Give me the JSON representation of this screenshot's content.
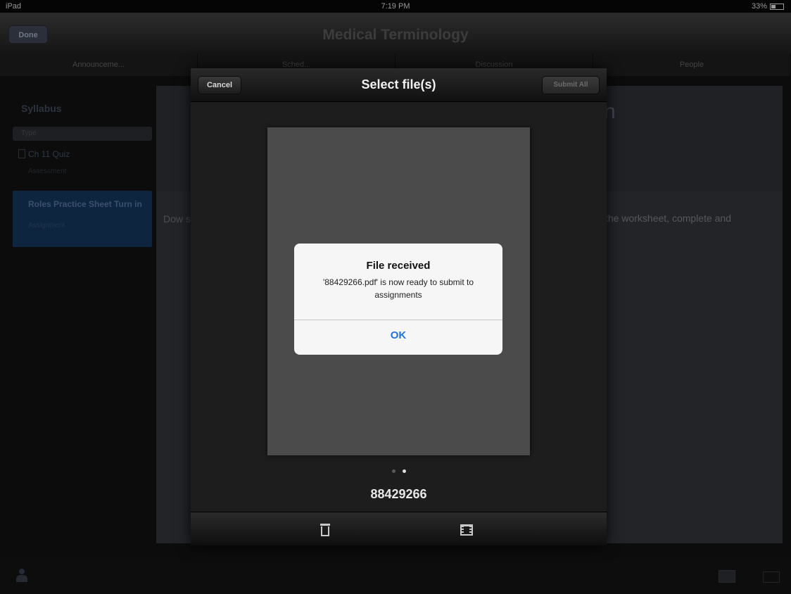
{
  "status_bar": {
    "carrier": "iPad",
    "time": "7:19 PM",
    "battery": "33%"
  },
  "nav": {
    "done_label": "Done",
    "title": "Medical Terminology"
  },
  "tabs": [
    {
      "label": "Announceme..."
    },
    {
      "label": "Sched..."
    },
    {
      "label": "Discussion"
    },
    {
      "label": "People"
    }
  ],
  "sidebar": {
    "title": "Syllabus",
    "filter_label": "Type",
    "items": [
      {
        "label": "Ch 11 Quiz",
        "sub": "Assessment"
      },
      {
        "label": "Roles Practice Sheet Turn in",
        "sub": "Assignment"
      }
    ]
  },
  "content": {
    "heading_fragment": "n",
    "text_left": "Dow subr",
    "text_right": "the worksheet, complete and"
  },
  "sheet": {
    "cancel_label": "Cancel",
    "title": "Select file(s)",
    "submit_label": "Submit All",
    "file_name": "88429266",
    "page_count": 2,
    "active_page": 2
  },
  "alert": {
    "title": "File received",
    "message": "'88429266.pdf' is now ready to submit to assignments",
    "ok_label": "OK"
  },
  "icons": {
    "trash": "trash-icon",
    "film": "film-strip-icon",
    "person": "person-icon",
    "image": "image-icon",
    "mail": "mail-icon"
  },
  "colors": {
    "accent": "#1e73e8",
    "sheet_bg": "#1d1d1d"
  }
}
